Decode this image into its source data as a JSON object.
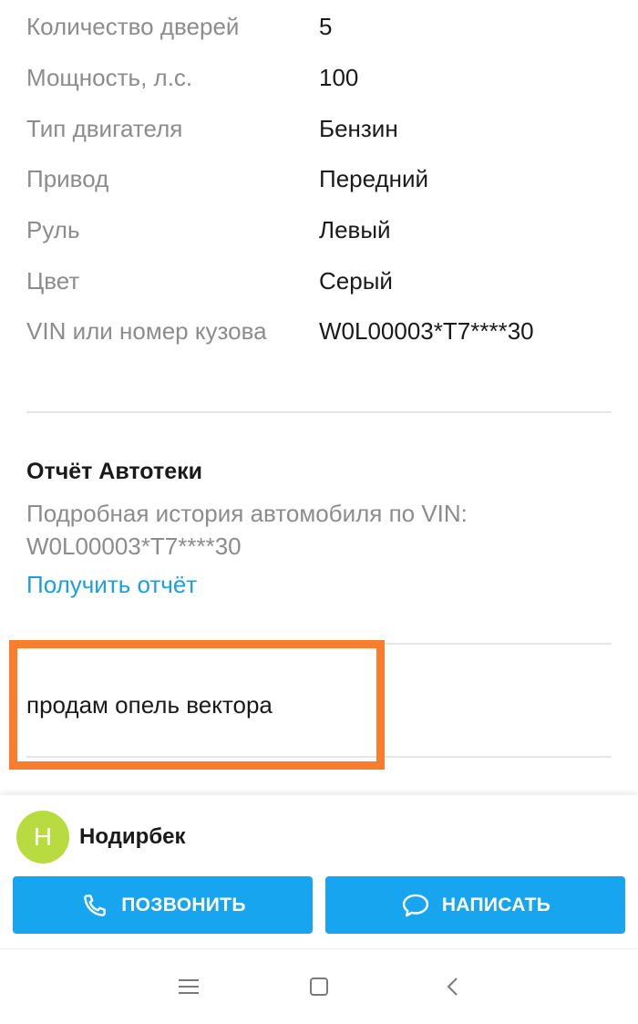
{
  "specs": [
    {
      "label": "Количество дверей",
      "value": "5"
    },
    {
      "label": "Мощность, л.с.",
      "value": "100"
    },
    {
      "label": "Тип двигателя",
      "value": "Бензин"
    },
    {
      "label": "Привод",
      "value": "Передний"
    },
    {
      "label": "Руль",
      "value": "Левый"
    },
    {
      "label": "Цвет",
      "value": "Серый"
    },
    {
      "label": "VIN или номер кузова",
      "value": "W0L00003*T7****30"
    }
  ],
  "report": {
    "title": "Отчёт Автотеки",
    "description": "Подробная история автомобиля по VIN: W0L00003*T7****30",
    "link": "Получить отчёт"
  },
  "listing": {
    "description": "продам опель вектора"
  },
  "seller": {
    "initial": "Н",
    "name": "Нодирбек"
  },
  "actions": {
    "call_label": "ПОЗВОНИТЬ",
    "write_label": "НАПИСАТЬ"
  },
  "icons": {
    "call": "phone-icon",
    "write": "chat-bubble-icon",
    "nav_menu": "menu-icon",
    "nav_home": "home-square-icon",
    "nav_back": "back-chevron-icon"
  },
  "colors": {
    "accent": "#17a5ef",
    "link": "#1a9fe0",
    "highlight": "#f97d2a",
    "avatar": "#b8dc40",
    "muted_text": "#8c8c8c"
  }
}
